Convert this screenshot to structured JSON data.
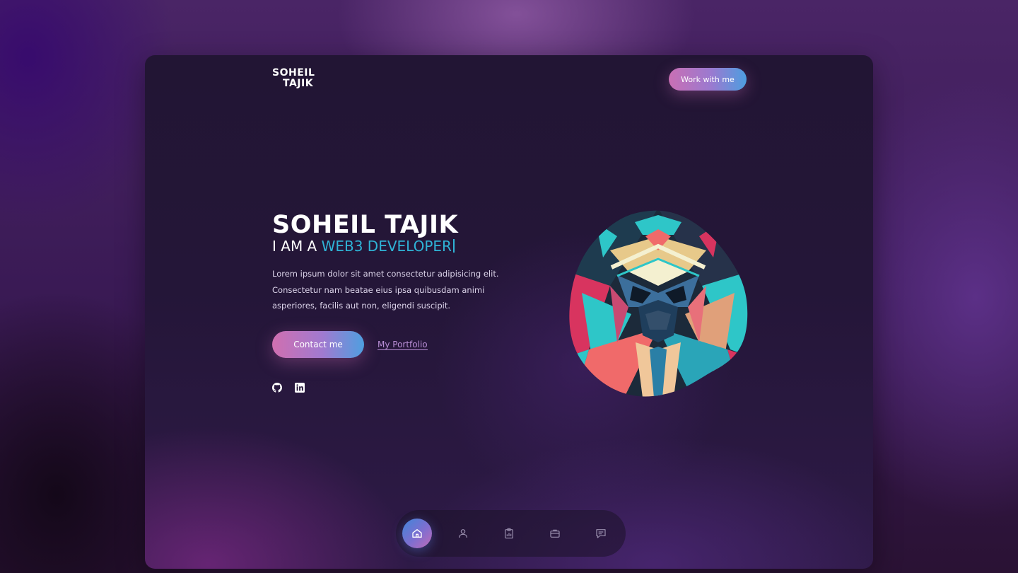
{
  "header": {
    "logo_line1": "SOHEIL",
    "logo_line2": "TAJIK",
    "cta_label": "Work with me"
  },
  "hero": {
    "name": "SOHEIL TAJIK",
    "subtitle_prefix": "I AM A ",
    "subtitle_role": "WEB3 DEVELOPER",
    "description": "Lorem ipsum dolor sit amet consectetur adipisicing elit. Consectetur nam beatae eius ipsa quibusdam animi asperiores, facilis aut non, eligendi suscipit.",
    "contact_label": "Contact me",
    "portfolio_label": "My Portfolio"
  },
  "social": [
    {
      "icon": "github-icon"
    },
    {
      "icon": "linkedin-icon"
    }
  ],
  "portrait": {
    "icon": "geometric-portrait-avatar"
  },
  "bottom_nav": {
    "active": "home",
    "items": [
      {
        "icon": "home-icon"
      },
      {
        "icon": "user-icon"
      },
      {
        "icon": "clipboard-chart-icon"
      },
      {
        "icon": "briefcase-icon"
      },
      {
        "icon": "chat-icon"
      }
    ]
  },
  "colors": {
    "accent_cyan": "#2fb3d6",
    "gradient_pink": "#d06fb0",
    "gradient_blue": "#4f9fe0",
    "link_purple": "#b98ed6",
    "panel_bg": "#221534"
  }
}
